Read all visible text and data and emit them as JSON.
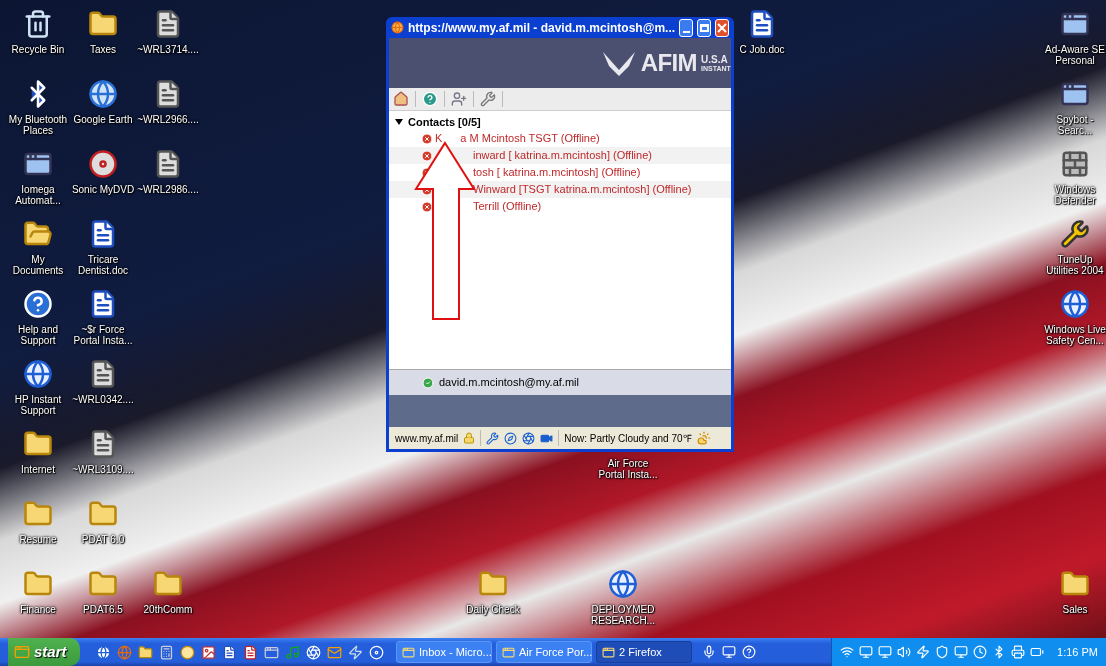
{
  "desktop_icons": [
    {
      "label": "Recycle Bin",
      "kind": "recycle"
    },
    {
      "label": "Taxes",
      "kind": "folder"
    },
    {
      "label": "~WRL3714....",
      "kind": "file"
    },
    {
      "label": "My Bluetooth Places",
      "kind": "bluetooth"
    },
    {
      "label": "Google Earth",
      "kind": "globe"
    },
    {
      "label": "~WRL2966....",
      "kind": "file"
    },
    {
      "label": "Iomega Automat...",
      "kind": "app"
    },
    {
      "label": "Sonic MyDVD",
      "kind": "disc"
    },
    {
      "label": "~WRL2986....",
      "kind": "file"
    },
    {
      "label": "My Documents",
      "kind": "documents"
    },
    {
      "label": "Tricare Dentist.doc",
      "kind": "word"
    },
    {
      "label": "Help and Support",
      "kind": "help"
    },
    {
      "label": "~$r Force Portal Insta...",
      "kind": "word"
    },
    {
      "label": "HP Instant Support",
      "kind": "ie"
    },
    {
      "label": "~WRL0342....",
      "kind": "file"
    },
    {
      "label": "Internet",
      "kind": "folder"
    },
    {
      "label": "~WRL3109....",
      "kind": "file"
    },
    {
      "label": "Resume",
      "kind": "folder"
    },
    {
      "label": "PDAT 6.0",
      "kind": "folder"
    },
    {
      "label": "Finance",
      "kind": "folder"
    },
    {
      "label": "PDAT6.5",
      "kind": "folder"
    },
    {
      "label": "20thComm",
      "kind": "folder"
    },
    {
      "label": "Air Force Portal Insta...",
      "kind": "hidden"
    },
    {
      "label": "C Job.doc",
      "kind": "word"
    },
    {
      "label": "Daily Check",
      "kind": "folder"
    },
    {
      "label": "DEPLOYMED RESEARCH...",
      "kind": "ie"
    },
    {
      "label": "Ad-Aware SE Personal",
      "kind": "app"
    },
    {
      "label": "Spybot - Searc...",
      "kind": "app"
    },
    {
      "label": "Windows Defender",
      "kind": "wall"
    },
    {
      "label": "TuneUp Utilities 2004",
      "kind": "tools"
    },
    {
      "label": "Windows Live Safety Cen...",
      "kind": "ie"
    },
    {
      "label": "Sales",
      "kind": "folder"
    }
  ],
  "window": {
    "title": "https://www.my.af.mil - david.m.mcintosh@m...",
    "banner": {
      "logo": "AFIM",
      "line_1": "U.S.A",
      "line_2": "INSTANT"
    },
    "contacts": {
      "header": "Contacts [0/5]",
      "expanded": true,
      "rows": [
        {
          "online": false,
          "segments": [
            "K",
            "a M Mcintosh TSGT (Offline)"
          ]
        },
        {
          "online": false,
          "segments": [
            "inward [ katrina.m.mcintosh] (Offline)"
          ]
        },
        {
          "online": false,
          "segments": [
            "tosh [ katrina.m.mcintosh] (Offline)"
          ]
        },
        {
          "online": false,
          "segments": [
            "Winward [TSGT katrina.m.mcintosh] (Offline)"
          ]
        },
        {
          "online": false,
          "segments": [
            "Terrill (Offline)"
          ]
        }
      ]
    },
    "self": {
      "online": true,
      "address": "david.m.mcintosh@my.af.mil"
    },
    "status_bar": {
      "site": "www.my.af.mil",
      "weather": "Now: Partly Cloudy and 70℉"
    }
  },
  "taskbar": {
    "start": "start",
    "tasks": [
      {
        "label": "Inbox - Micro...",
        "selected": false
      },
      {
        "label": "Air Force Por...",
        "selected": false
      },
      {
        "label": "2 Firefox",
        "selected": true
      }
    ],
    "clock": "1:16 PM"
  }
}
